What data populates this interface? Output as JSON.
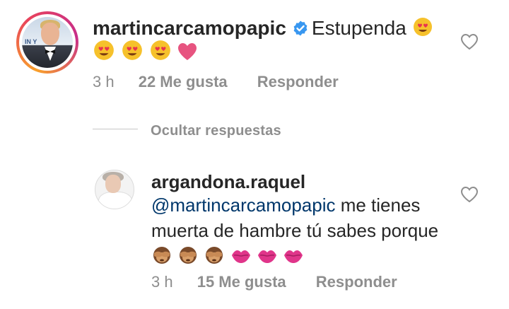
{
  "comments": [
    {
      "username": "martincarcamopapic",
      "verified": true,
      "text": "Estupenda",
      "emojis_line1": [
        "heart-eyes-emoji"
      ],
      "emojis_line2": [
        "heart-eyes-emoji",
        "heart-eyes-emoji",
        "heart-eyes-emoji",
        "pink-heart-emoji"
      ],
      "time": "3 h",
      "likes": "22 Me gusta",
      "reply": "Responder"
    },
    {
      "username": "argandona.raquel",
      "mention": "@martincarcamopapic",
      "text_after_mention": " me tienes muerta de hambre tú sabes porque",
      "emojis": [
        "see-no-evil-monkey-emoji",
        "see-no-evil-monkey-emoji",
        "see-no-evil-monkey-emoji",
        "kiss-mark-emoji",
        "kiss-mark-emoji",
        "kiss-mark-emoji"
      ],
      "time": "3 h",
      "likes": "15 Me gusta",
      "reply": "Responder"
    }
  ],
  "hide_replies_label": "Ocultar respuestas",
  "colors": {
    "text": "#262626",
    "meta": "#8e8e8e",
    "mention": "#00376b",
    "verified": "#3897f0",
    "heart": "#e75480"
  }
}
